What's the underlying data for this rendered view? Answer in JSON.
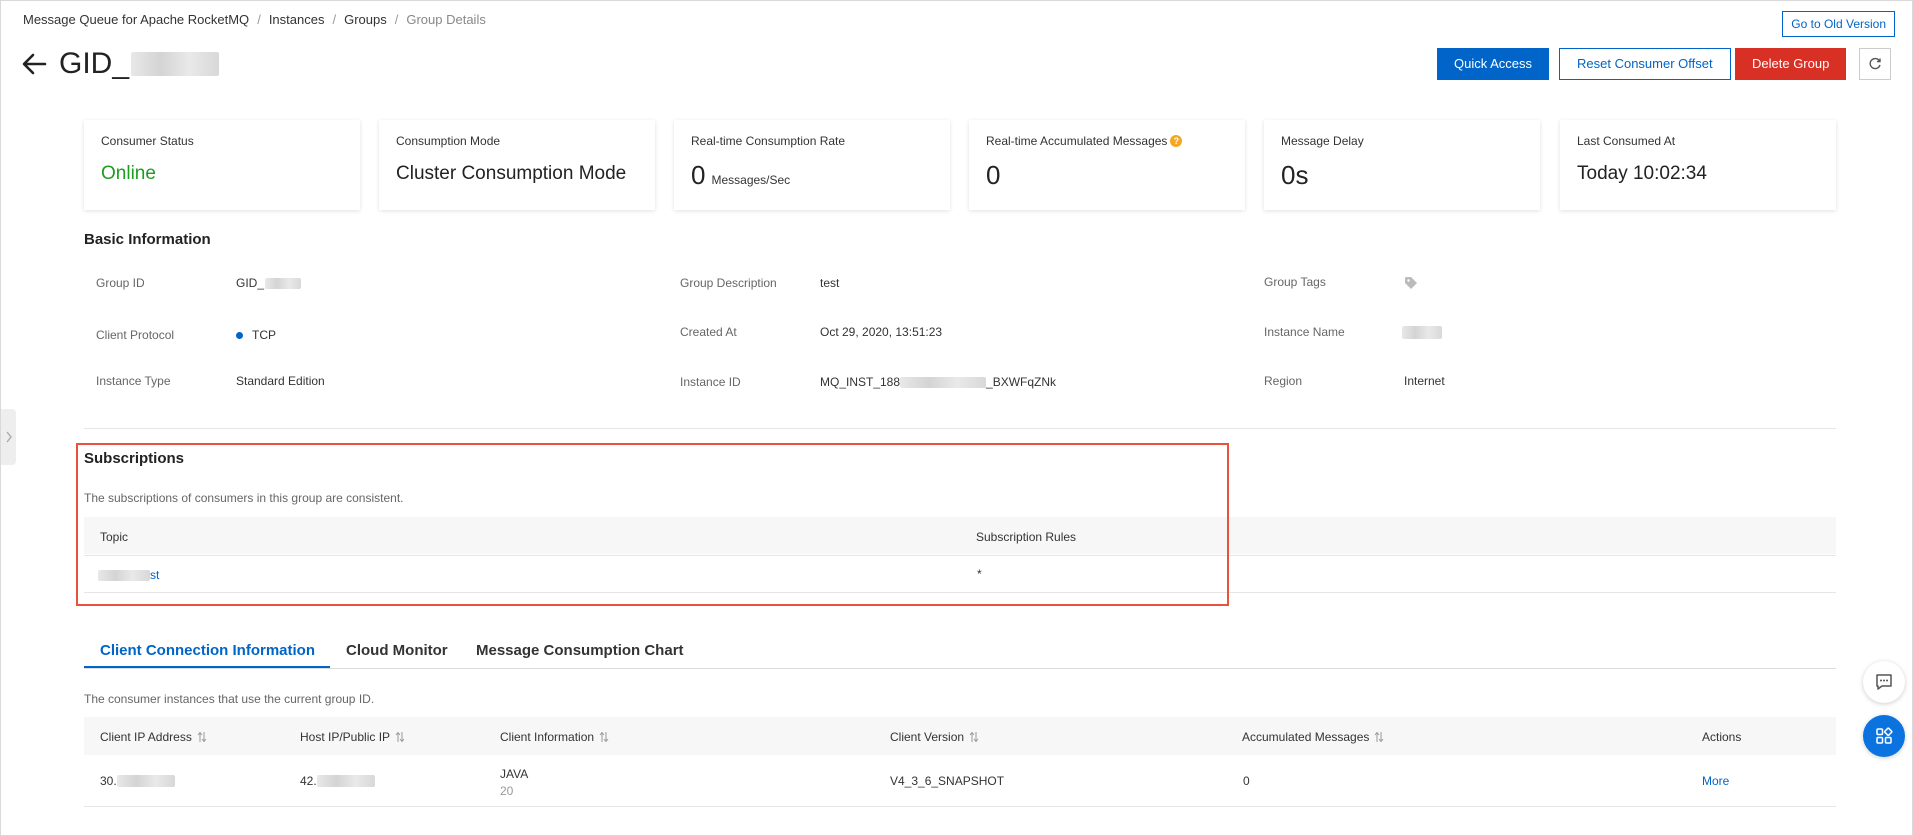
{
  "breadcrumb": {
    "items": [
      "Message Queue for Apache RocketMQ",
      "Instances",
      "Groups"
    ],
    "current": "Group Details"
  },
  "header": {
    "title_prefix": "GID_",
    "old_version_label": "Go to Old Version",
    "quick_access_label": "Quick Access",
    "reset_offset_label": "Reset Consumer Offset",
    "delete_group_label": "Delete Group"
  },
  "cards": {
    "consumer_status": {
      "label": "Consumer Status",
      "value": "Online"
    },
    "consumption_mode": {
      "label": "Consumption Mode",
      "value": "Cluster Consumption Mode"
    },
    "consumption_rate": {
      "label": "Real-time Consumption Rate",
      "value": "0",
      "unit": "Messages/Sec"
    },
    "accumulated": {
      "label": "Real-time Accumulated Messages",
      "value": "0"
    },
    "delay": {
      "label": "Message Delay",
      "value": "0s"
    },
    "last_consumed": {
      "label": "Last Consumed At",
      "value": "Today 10:02:34"
    }
  },
  "basic_info": {
    "title": "Basic Information",
    "group_id_label": "Group ID",
    "group_id_value": "GID_",
    "client_protocol_label": "Client Protocol",
    "client_protocol_value": "TCP",
    "instance_type_label": "Instance Type",
    "instance_type_value": "Standard Edition",
    "group_description_label": "Group Description",
    "group_description_value": "test",
    "created_at_label": "Created At",
    "created_at_value": "Oct 29, 2020, 13:51:23",
    "instance_id_label": "Instance ID",
    "instance_id_prefix": "MQ_INST_188",
    "instance_id_suffix": "_BXWFqZNk",
    "group_tags_label": "Group Tags",
    "instance_name_label": "Instance Name",
    "region_label": "Region",
    "region_value": "Internet"
  },
  "subscriptions": {
    "title": "Subscriptions",
    "note": "The subscriptions of consumers in this group are consistent.",
    "columns": [
      "Topic",
      "Subscription Rules"
    ],
    "rows": [
      {
        "topic_suffix": "st",
        "rule": "*"
      }
    ]
  },
  "tabs": [
    {
      "label": "Client Connection Information"
    },
    {
      "label": "Cloud Monitor"
    },
    {
      "label": "Message Consumption Chart"
    }
  ],
  "clients": {
    "note": "The consumer instances that use the current group ID.",
    "columns": [
      "Client IP Address",
      "Host IP/Public IP",
      "Client Information",
      "Client Version",
      "Accumulated Messages",
      "Actions"
    ],
    "rows": [
      {
        "client_ip_prefix": "30.",
        "host_ip_prefix": "42.",
        "client_info_lang": "JAVA",
        "client_info_num": "20",
        "version": "V4_3_6_SNAPSHOT",
        "accumulated": "0",
        "action": "More"
      }
    ]
  },
  "colors": {
    "accent": "#0064c8",
    "danger": "#d93026",
    "online": "#1e9d1e",
    "highlight_frame": "#e8533a"
  },
  "icons": [
    "arrow-left-icon",
    "refresh-icon",
    "chevron-right-icon",
    "help-icon",
    "tag-icon",
    "sort-icon",
    "chat-icon",
    "apps-icon"
  ]
}
